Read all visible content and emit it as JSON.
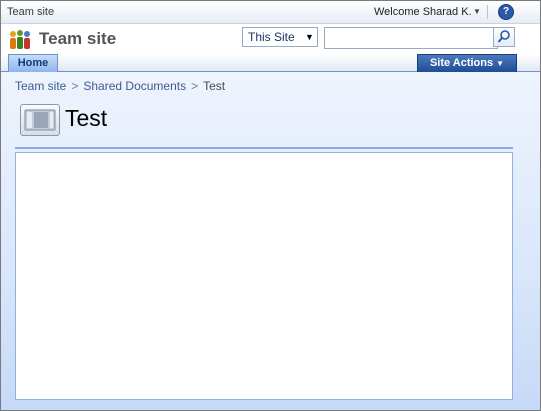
{
  "global_bar": {
    "site_label": "Team site",
    "welcome_text": "Welcome Sharad K.",
    "help_glyph": "?"
  },
  "title_area": {
    "site_title": "Team site",
    "logo_icon": "sharepoint-people-logo-icon",
    "search_scope": "This Site",
    "search_placeholder": "",
    "search_icon": "magnifier-icon"
  },
  "nav": {
    "home_tab": "Home",
    "site_actions": "Site Actions"
  },
  "breadcrumb": {
    "items": [
      "Team site",
      "Shared Documents"
    ],
    "current": "Test",
    "separator": ">"
  },
  "page": {
    "title": "Test",
    "icon": "web-part-page-icon"
  },
  "colors": {
    "nav_accent": "#1f4d96",
    "home_tab": "#8fb5ea",
    "content_bg": "#d9e6fb"
  }
}
